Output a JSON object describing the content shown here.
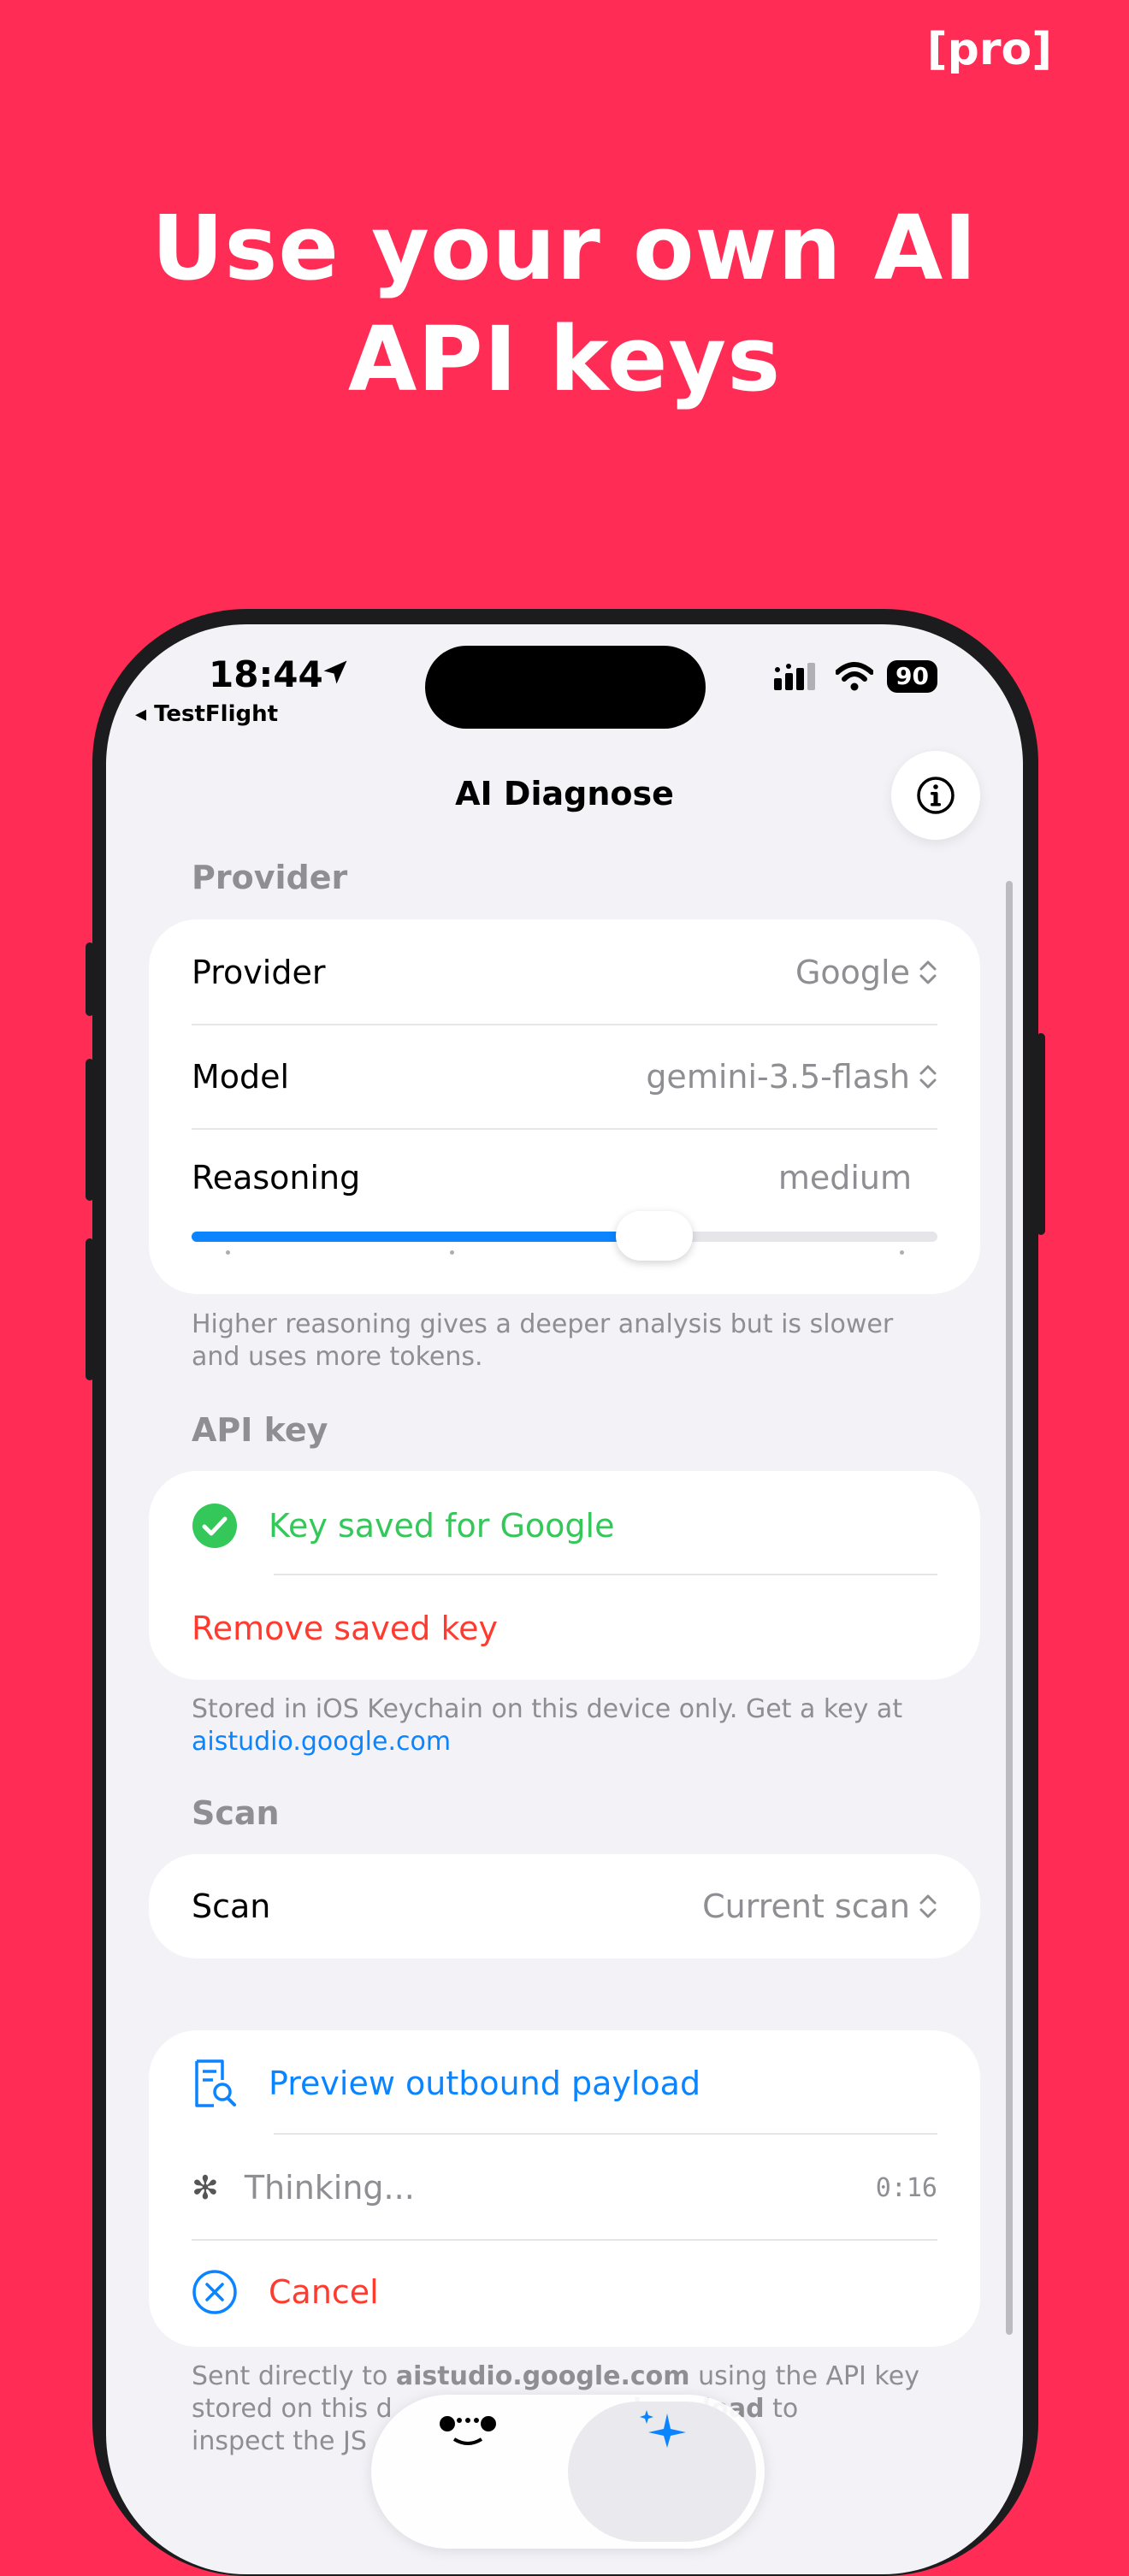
{
  "promo": {
    "badge": "[pro]",
    "headline": "Use your own AI API keys"
  },
  "status_bar": {
    "time": "18:44",
    "back_label": "◂ TestFlight",
    "battery": "90"
  },
  "nav": {
    "title": "AI Diagnose"
  },
  "provider_section": {
    "header": "Provider",
    "provider_label": "Provider",
    "provider_value": "Google",
    "model_label": "Model",
    "model_value": "gemini-3.5-flash",
    "reasoning_label": "Reasoning",
    "reasoning_value": "medium",
    "reasoning_level_fraction": 0.62,
    "footer": "Higher reasoning gives a deeper analysis but is slower and uses more tokens."
  },
  "api_key_section": {
    "header": "API key",
    "status": "Key saved for Google",
    "remove_label": "Remove saved key",
    "footer_prefix": "Stored in iOS Keychain on this device only. Get a key at",
    "footer_link": "aistudio.google.com"
  },
  "scan_section": {
    "header": "Scan",
    "scan_label": "Scan",
    "scan_value": "Current scan"
  },
  "actions_section": {
    "preview_label": "Preview outbound payload",
    "thinking_label": "Thinking...",
    "timer": "0:16",
    "cancel_label": "Cancel",
    "footer_line1_a": "Sent directly to ",
    "footer_line1_b": "aistudio.google.com",
    "footer_line1_c": " using the API key",
    "footer_line2_a": "stored on this d",
    "footer_line2_b": "d payload",
    "footer_line2_c": " to",
    "footer_line3": "inspect the JS"
  },
  "colors": {
    "background": "#FF2D55",
    "accent": "#0A84FF",
    "success": "#34C759",
    "destructive": "#FF3B30"
  }
}
